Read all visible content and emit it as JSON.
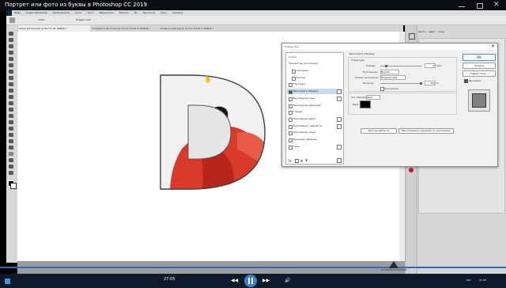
{
  "video_title": "Портрет или фото из буквы в Photoshop CC 2019",
  "ps_menu": [
    "Файл",
    "Редактирование",
    "Изображение",
    "Слои",
    "Текст",
    "Выделение",
    "Фильтр",
    "3D",
    "Просмотр",
    "Окно",
    "Справка"
  ],
  "doc_tabs": [
    "Letter Portrait.psd @ 66,7% (D, RGB/8) *",
    "Сохранить фото.psd @ 16,7% (Слой 1, RGB/8) *",
    "Amazing pose.jpg @ 16,7% (Слой 1, RGB/8) *"
  ],
  "panel_tabs": [
    "Кисти",
    "Цвет",
    "Слои"
  ],
  "options_value": "100%",
  "options_mode": "Новый слой",
  "dialog": {
    "title": "Стиль слоя",
    "styles_header": "Стили",
    "blend_options": "Параметры наложения",
    "effects": [
      "Тиснение",
      "Контур",
      "Текстура",
      "Выполнить обводку",
      "Внутренняя тень",
      "Внутреннее свечение",
      "Глянец",
      "Наложение цвета",
      "Наложение градиента",
      "Наложение узора",
      "Внешнее свечение",
      "Тень"
    ],
    "section_title": "Выполнить обводку",
    "subsection": "Структура",
    "size_label": "Размер:",
    "size_value": "5",
    "size_unit": "пикс",
    "position_label": "Положение:",
    "position_value": "Внутри",
    "blend_label": "Режим наложения:",
    "blend_value": "Нормальный",
    "opacity_label": "Непрозр.:",
    "opacity_value": "100",
    "opacity_unit": "%",
    "overprint": "Наложение",
    "fill_type_label": "Тип обводки:",
    "fill_type_value": "Цвет",
    "color_label": "Цвет:",
    "default_btn": "Использовать по умолчанию",
    "restore_btn": "Восстановить значения по умолчанию",
    "ok": "OK",
    "cancel": "Отмена",
    "new_style": "Новый стиль...",
    "preview": "Просмотр"
  },
  "status_left": "66,67%",
  "status_doc": "Док: 1,30М/4,38М",
  "video_time": "27:05",
  "watermark": "ВАСИЛИЙ КУЗНЕЦОВ",
  "taskbar_time": "11:28",
  "taskbar_lang": "РУС",
  "letter": "D",
  "colors": {
    "accent": "#4a90d9",
    "dress": "#e24a3a"
  }
}
